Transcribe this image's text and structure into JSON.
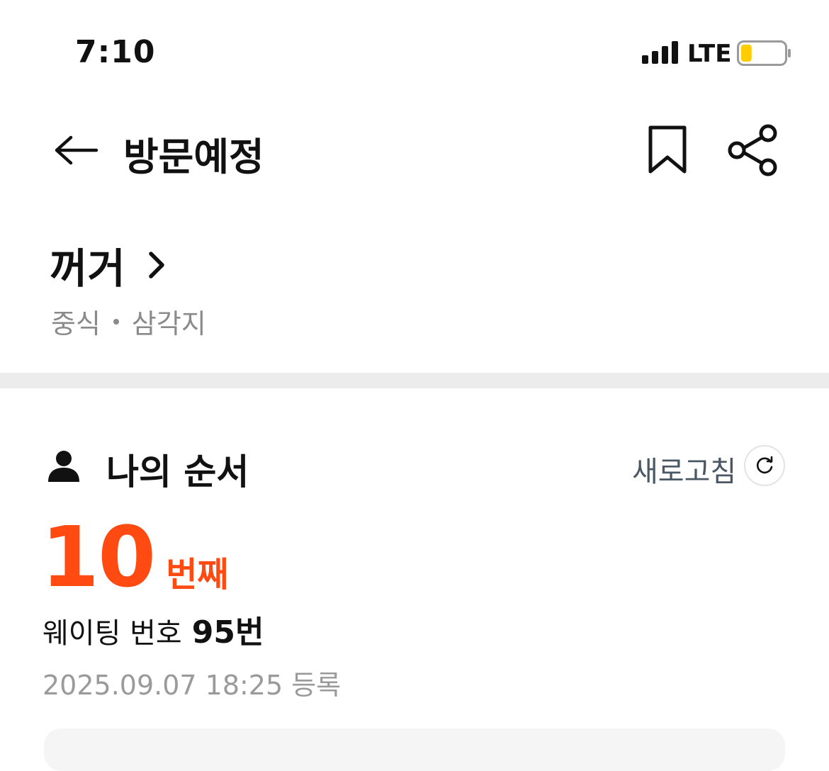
{
  "status_bar": {
    "time": "7:10",
    "network": "LTE",
    "battery_level": 0.25,
    "battery_color": "#ffcc00"
  },
  "header": {
    "title": "방문예정",
    "back_icon": "arrow-left-icon",
    "bookmark_icon": "bookmark-icon",
    "share_icon": "share-icon"
  },
  "store": {
    "name": "꺼거",
    "category": "중식",
    "location": "삼각지"
  },
  "my_order": {
    "title": "나의 순서",
    "refresh_label": "새로고침",
    "position_number": "10",
    "position_suffix": "번째",
    "waiting_label": "웨이팅 번호",
    "waiting_number": "95번",
    "registered_at": "2025.09.07 18:25 등록"
  },
  "colors": {
    "accent": "#ff4b12",
    "muted_text": "#8a8a8a",
    "divider": "#ececec"
  }
}
